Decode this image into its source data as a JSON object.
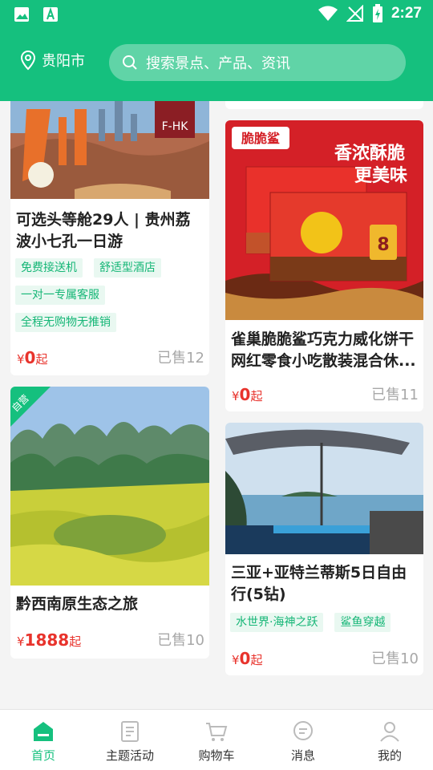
{
  "status_bar": {
    "time": "2:27"
  },
  "header": {
    "location": "贵阳市",
    "search_placeholder": "搜索景点、产品、资讯"
  },
  "colors": {
    "brand": "#15c07e",
    "price": "#e8332c",
    "tag_bg": "#e9f8f1",
    "tag_text": "#15b676"
  },
  "products": [
    {
      "title": "可选头等舱29人 | 贵州荔波小七孔一日游",
      "image_caption": "F-HK",
      "tags": [
        "免费接送机",
        "舒适型酒店",
        "一对一专属客服",
        "全程无购物无推销"
      ],
      "price_prefix": "¥",
      "price": "0",
      "price_suffix": "起",
      "sold": "已售12"
    },
    {
      "title": "黔西南原生态之旅",
      "badge": "自营",
      "tags": [],
      "price_prefix": "¥",
      "price": "1888",
      "price_suffix": "起",
      "sold": "已售10"
    },
    {
      "title": "雀巢脆脆鲨巧克力威化饼干网红零食小吃散装混合休...",
      "image_brand": "脆脆鲨",
      "image_slogan_1": "香浓酥脆",
      "image_slogan_2": "更美味",
      "image_count": "8",
      "tags": [],
      "price_prefix": "¥",
      "price": "0",
      "price_suffix": "起",
      "sold": "已售11"
    },
    {
      "title": "三亚+亚特兰蒂斯5日自由行(5钻)",
      "tags": [
        "水世界·海神之跃",
        "鲨鱼穿越"
      ],
      "price_prefix": "¥",
      "price": "0",
      "price_suffix": "起",
      "sold": "已售10"
    }
  ],
  "tabbar": {
    "items": [
      {
        "label": "首页",
        "icon": "home-icon",
        "active": true
      },
      {
        "label": "主题活动",
        "icon": "document-icon",
        "active": false
      },
      {
        "label": "购物车",
        "icon": "cart-icon",
        "active": false
      },
      {
        "label": "消息",
        "icon": "chat-icon",
        "active": false
      },
      {
        "label": "我的",
        "icon": "user-icon",
        "active": false
      }
    ]
  }
}
